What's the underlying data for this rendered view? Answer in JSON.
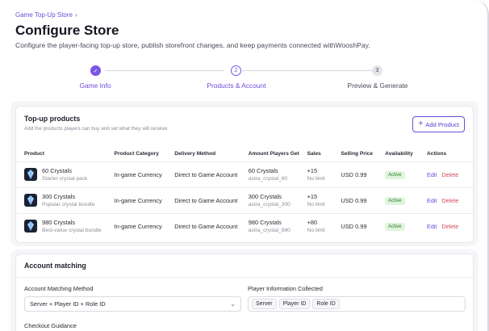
{
  "breadcrumb": {
    "label": "Game Top-Up Store",
    "separator": "›"
  },
  "page": {
    "title": "Configure Store",
    "subtitle": "Configure the player-facing top-up store, publish storefront changes, and keep payments connected withWooshPay."
  },
  "stepper": {
    "steps": [
      {
        "number": "✓",
        "label": "Game Info",
        "state": "done"
      },
      {
        "number": "2",
        "label": "Products & Account",
        "state": "active"
      },
      {
        "number": "3",
        "label": "Preview & Generate",
        "state": "pending"
      }
    ]
  },
  "colors": {
    "accent": "#6d4bd8",
    "danger": "#d24a5a",
    "success_bg": "#dff4dc",
    "success_text": "#2e7d2e"
  },
  "products": {
    "title": "Top-up products",
    "description": "Add the products players can buy and set what they will receive.",
    "add_button": {
      "icon": "plus-icon",
      "label": "Add Product"
    },
    "columns": [
      "Product",
      "Product Category",
      "Delivery Method",
      "Amount Players Get",
      "Sales",
      "Selling Price",
      "Availability",
      "Actions"
    ],
    "rows": [
      {
        "name": "60 Crystals",
        "desc": "Starter crystal pack",
        "category": "In-game Currency",
        "delivery": "Direct to Game Account",
        "amount": "60 Crystals",
        "amount_id": "astra_crystal_60",
        "sales": "+15",
        "limit": "No limit",
        "price": "USD 0.99",
        "availability": "Active",
        "edit": "Edit",
        "delete": "Delete"
      },
      {
        "name": "300 Crystals",
        "desc": "Popular crystal bundle",
        "category": "In-game Currency",
        "delivery": "Direct to Game Account",
        "amount": "300 Crystals",
        "amount_id": "astra_crystal_300",
        "sales": "+15",
        "limit": "No limit",
        "price": "USD 0.99",
        "availability": "Active",
        "edit": "Edit",
        "delete": "Delete"
      },
      {
        "name": "980 Crystals",
        "desc": "Best-value crystal bundle",
        "category": "In-game Currency",
        "delivery": "Direct to Game Account",
        "amount": "980 Crystals",
        "amount_id": "astra_crystal_980",
        "sales": "+80",
        "limit": "No limit",
        "price": "USD 0.99",
        "availability": "Active",
        "edit": "Edit",
        "delete": "Delete"
      }
    ]
  },
  "account": {
    "title": "Account matching",
    "method_label": "Account Matching Method",
    "method_value": "Server + Player ID + Role ID",
    "info_label": "Player Information Collected",
    "info_chips": [
      "Server",
      "Player ID",
      "Role ID"
    ],
    "guidance_label": "Checkout Guidance"
  }
}
